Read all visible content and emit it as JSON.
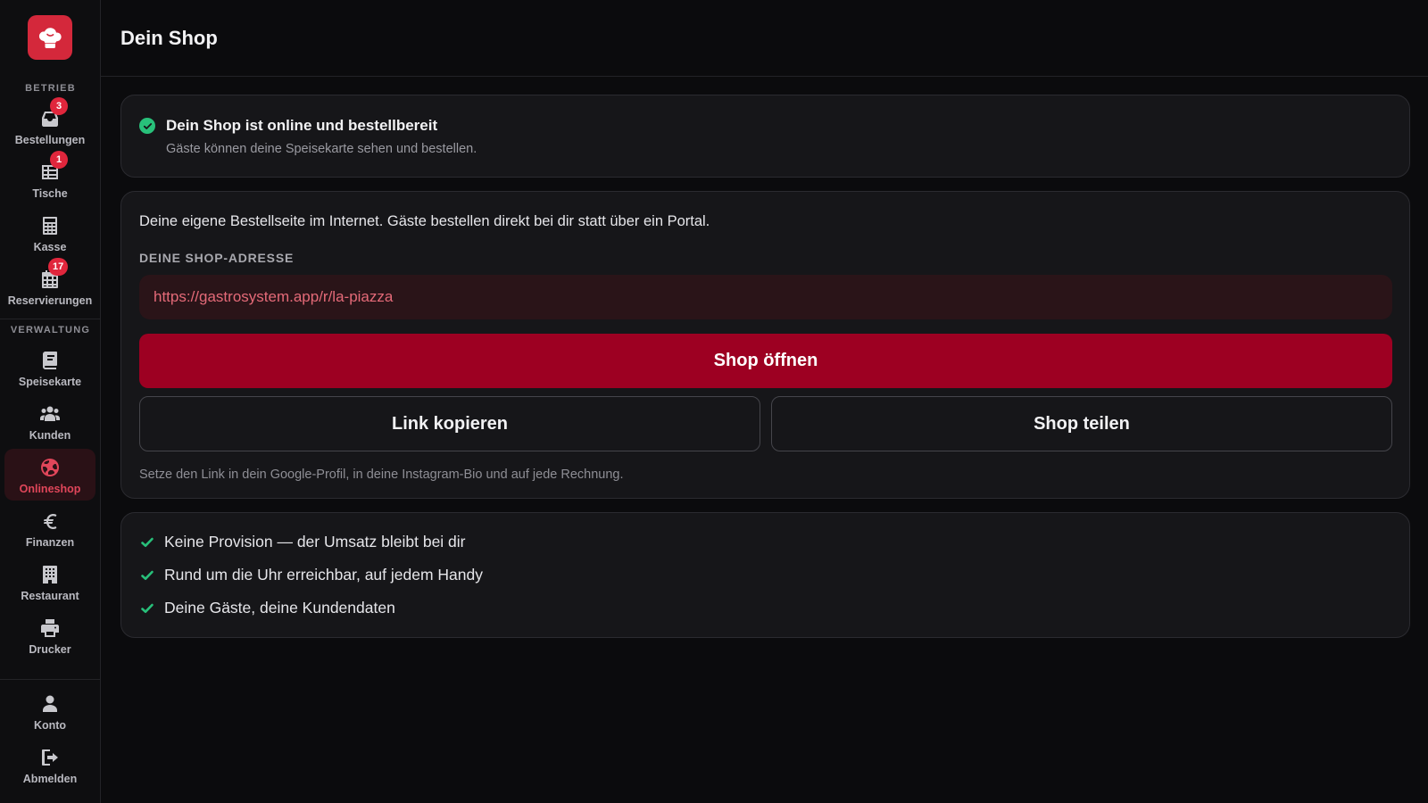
{
  "sidebar": {
    "sections": {
      "operation": "BETRIEB",
      "management": "VERWALTUNG"
    },
    "items": [
      {
        "label": "Bestellungen",
        "icon": "inbox-icon",
        "badge": "3"
      },
      {
        "label": "Tische",
        "icon": "table-grid-icon",
        "badge": "1"
      },
      {
        "label": "Kasse",
        "icon": "calculator-icon",
        "badge": null
      },
      {
        "label": "Reservierungen",
        "icon": "calendar-icon",
        "badge": "17"
      },
      {
        "label": "Speisekarte",
        "icon": "book-icon",
        "badge": null
      },
      {
        "label": "Kunden",
        "icon": "users-icon",
        "badge": null
      },
      {
        "label": "Onlineshop",
        "icon": "globe-icon",
        "badge": null,
        "active": true
      },
      {
        "label": "Finanzen",
        "icon": "euro-icon",
        "badge": null
      },
      {
        "label": "Restaurant",
        "icon": "building-icon",
        "badge": null
      },
      {
        "label": "Drucker",
        "icon": "printer-icon",
        "badge": null
      },
      {
        "label": "Konto",
        "icon": "user-icon",
        "badge": null
      },
      {
        "label": "Abmelden",
        "icon": "logout-icon",
        "badge": null
      }
    ]
  },
  "header": {
    "title": "Dein Shop"
  },
  "status": {
    "title": "Dein Shop ist online und bestellbereit",
    "subtitle": "Gäste können deine Speisekarte sehen und bestellen."
  },
  "shop": {
    "intro": "Deine eigene Bestellseite im Internet. Gäste bestellen direkt bei dir statt über ein Portal.",
    "address_label": "DEINE SHOP-ADRESSE",
    "url": "https://gastrosystem.app/r/la-piazza",
    "open_label": "Shop öffnen",
    "copy_label": "Link kopieren",
    "share_label": "Shop teilen",
    "hint": "Setze den Link in dein Google-Profil, in deine Instagram-Bio und auf jede Rechnung."
  },
  "benefits": [
    "Keine Provision — der Umsatz bleibt bei dir",
    "Rund um die Uhr erreichbar, auf jedem Handy",
    "Deine Gäste, deine Kundendaten"
  ],
  "colors": {
    "accent": "#9d0022",
    "brand": "#d4283b",
    "success": "#28c07a",
    "badge": "#e0263c"
  }
}
